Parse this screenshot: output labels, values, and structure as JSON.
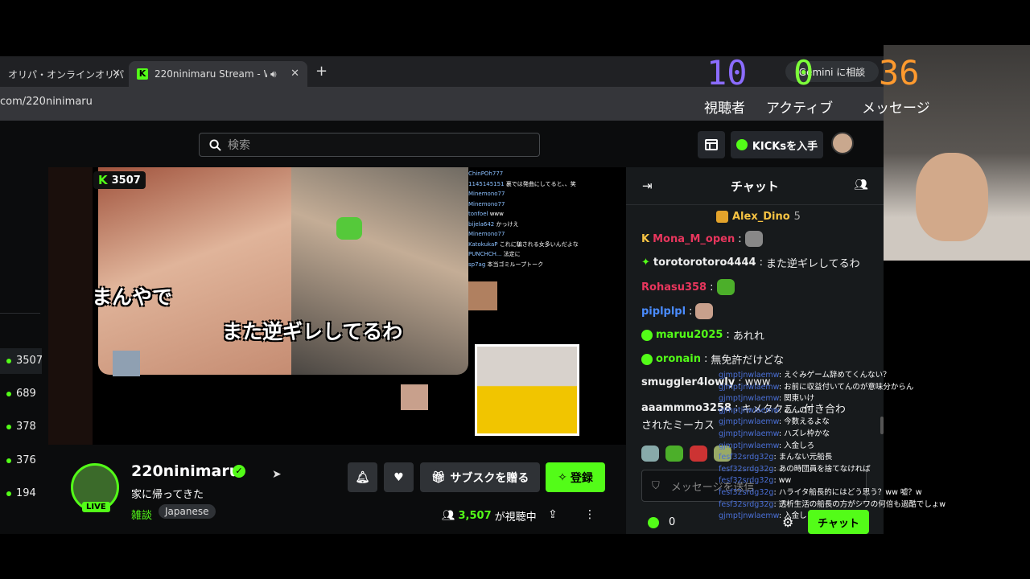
{
  "browser": {
    "tabs": [
      {
        "title": "オリパ・オンラインオリパ"
      },
      {
        "title": "220ninimaru Stream - Wa"
      }
    ],
    "new_tab": "+",
    "url": "com/220ninimaru"
  },
  "gemini_button": "Gemini に相談",
  "header": {
    "search_placeholder": "検索",
    "kicks_button": "KICKsを入手"
  },
  "sidebar": {
    "viewer_counts": [
      "3507",
      "689",
      "378",
      "376",
      "194"
    ]
  },
  "video": {
    "live_viewers": "3507",
    "captions": [
      "まんやで",
      "また逆ギレしてるわ"
    ],
    "mini_chat": [
      {
        "user": "ChinPOh777",
        "text": ""
      },
      {
        "user": "1145145151",
        "text": "裏では発曲にしてると、、笑"
      },
      {
        "user": "Minemono77",
        "text": ""
      },
      {
        "user": "Minemono77",
        "text": ""
      },
      {
        "user": "tonfoel",
        "text": "www"
      },
      {
        "user": "bijela642",
        "text": "かっけえ"
      },
      {
        "user": "Minemono77",
        "text": ""
      },
      {
        "user": "KatokukaP",
        "text": "これに騙される女多いんだよな"
      },
      {
        "user": "PUNCHCH...",
        "text": "法定に"
      },
      {
        "user": "sp7ag",
        "text": "本当ゴミループトーク"
      }
    ]
  },
  "channel": {
    "name": "220ninimaru",
    "title": "家に帰ってきた",
    "category": "雑談",
    "language_tag": "Japanese",
    "live_label": "LIVE",
    "viewer_count": "3,507",
    "viewer_suffix": "が視聴中",
    "subscribe_gift_label": "サブスクを贈る",
    "follow_label": "登録"
  },
  "chat": {
    "title": "チャット",
    "pinned_user": "Alex_Dino",
    "pinned_count": "5",
    "messages": [
      {
        "user": "Mona_M_open",
        "text": "",
        "color": "#e8365d"
      },
      {
        "user": "torotorotoro4444",
        "text": "また逆ギレしてるわ",
        "color": "#e6e6e6"
      },
      {
        "user": "Rohasu358",
        "text": "",
        "color": "#e8365d"
      },
      {
        "user": "piplplpl",
        "text": "",
        "color": "#4a8cff"
      },
      {
        "user": "maruu2025",
        "text": "あれれ",
        "color": "#53fc18"
      },
      {
        "user": "oronain",
        "text": "無免許だけどな",
        "color": "#53fc18"
      },
      {
        "user": "smuggler4lowly",
        "text": "www",
        "color": "#e6e6e6"
      },
      {
        "user": "aaammmo3258",
        "text": "キメタクこ...付き合わ",
        "color": "#e6e6e6"
      }
    ],
    "continuation": "されたミーカス",
    "input_placeholder": "メッセージを送信",
    "kicks_count": "0",
    "send_label": "チャット"
  },
  "overlay": {
    "stats": [
      {
        "value": "10",
        "label": "視聴者",
        "color": "#8b6cff"
      },
      {
        "value": "0",
        "label": "アクティブ",
        "color": "#7dff3a"
      },
      {
        "value": "36",
        "label": "メッセージ",
        "color": "#ff9a2e"
      }
    ],
    "comments": [
      {
        "user": "gjmptjnwlaemw",
        "text": "えぐみゲーム辞めてくんない？"
      },
      {
        "user": "gjmptjnwlaemw",
        "text": "お前に収益付いてんのが意味分からん"
      },
      {
        "user": "gjmptjnwlaemw",
        "text": "関東いけ"
      },
      {
        "user": "gjmptjnwlaemw",
        "text": "あんの？"
      },
      {
        "user": "gjmptjnwlaemw",
        "text": "今数えるよな"
      },
      {
        "user": "gjmptjnwlaemw",
        "text": "ハズレ枠かな"
      },
      {
        "user": "gjmptjnwlaemw",
        "text": "入金しろ"
      },
      {
        "user": "fesf32srdg32g",
        "text": "まんない元船長"
      },
      {
        "user": "fesf32srdg32g",
        "text": "あの時団員を捨てなければ"
      },
      {
        "user": "fesf32srdg32g",
        "text": "ww"
      },
      {
        "user": "fesf32srdg32g",
        "text": "ハライタ船長的にはどう思う？ww 嘘？w"
      },
      {
        "user": "fesf32srdg32g",
        "text": "透析生活の船長の方がシワの何倍も過酷でしょw"
      },
      {
        "user": "gjmptjnwlaemw",
        "text": "入金し"
      }
    ]
  }
}
